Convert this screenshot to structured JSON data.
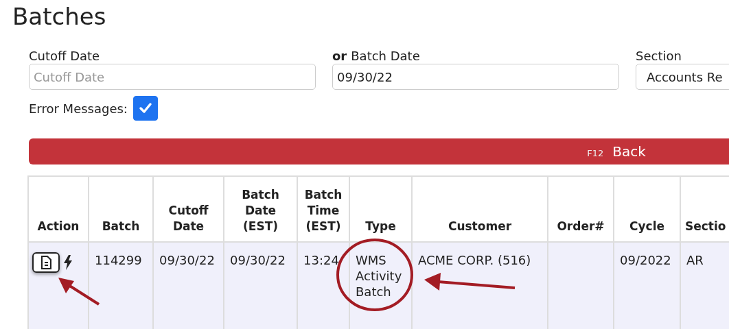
{
  "title": "Batches",
  "filters": [
    {
      "label": "Cutoff Date",
      "placeholder": "Cutoff Date",
      "kind": "text"
    },
    {
      "label": "Batch Date",
      "label_prefix": "or",
      "value": "09/30/22",
      "kind": "text"
    },
    {
      "label": "Section",
      "value": "Accounts Re",
      "kind": "select"
    }
  ],
  "error_messages": {
    "label": "Error Messages:",
    "checked": true
  },
  "back_button": {
    "shortcut": "F12",
    "label": "Back"
  },
  "table": {
    "columns": [
      "Action",
      "Batch",
      "Cutoff Date",
      "Batch Date (EST)",
      "Batch Time (EST)",
      "Type",
      "Customer",
      "Order#",
      "Cycle",
      "Sectio"
    ],
    "rows": [
      {
        "cells": [
          "",
          "114299",
          "09/30/22",
          "09/30/22",
          "13:24",
          "WMS Activity Batch",
          "ACME CORP. (516)",
          "",
          "09/2022",
          "AR"
        ]
      }
    ]
  }
}
